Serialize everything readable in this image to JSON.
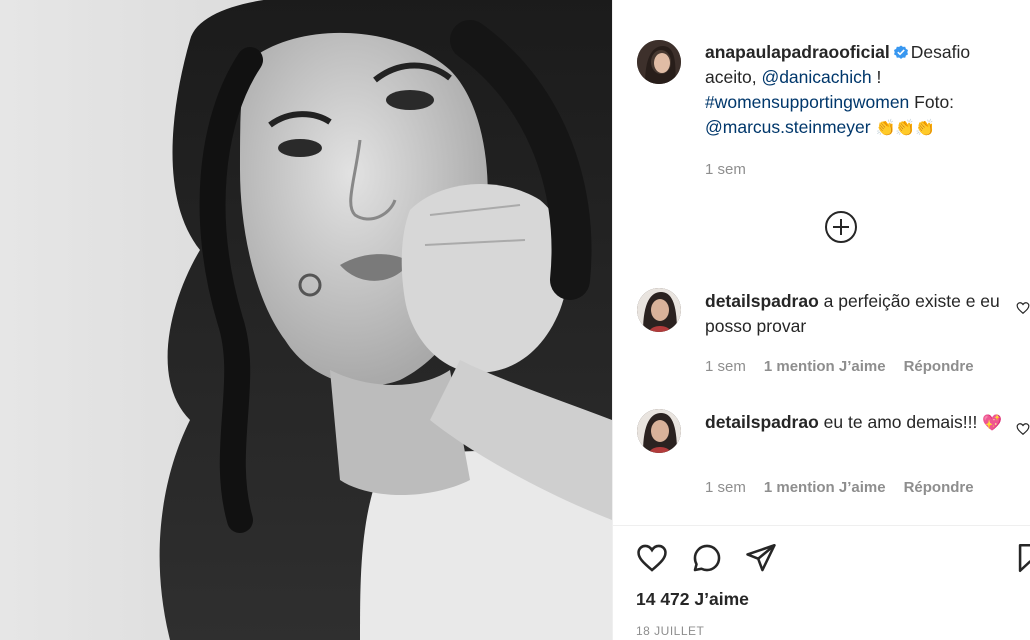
{
  "post": {
    "author": "anapaulapadraooficial",
    "caption_pre": "Desafio aceito, ",
    "mention_1": "@danicachich",
    "caption_mid": " ! ",
    "hashtag": "#womensupportingwomen",
    "caption_foto": " Foto: ",
    "mention_2": "@marcus.steinmeyer",
    "caption_emojis": "👏👏👏",
    "time": "1 sem"
  },
  "comments": [
    {
      "user": "detailspadrao",
      "text": "a perfeição existe e eu posso provar",
      "time": "1 sem",
      "likes": "1 mention J’aime",
      "reply": "Répondre"
    },
    {
      "user": "detailspadrao",
      "text": "eu te amo demais!!! ",
      "emoji": "💖",
      "time": "1 sem",
      "likes": "1 mention J’aime",
      "reply": "Répondre"
    }
  ],
  "footer": {
    "likes": "14 472 J’aime",
    "date": "18 JUILLET"
  },
  "colors": {
    "link": "#00376b",
    "secondary_text": "#8e8e8e",
    "verified": "#3897f0",
    "heart_emoji": "#d6263b"
  },
  "icons": [
    "verified-icon",
    "add-circle-icon",
    "heart-outline-icon",
    "comment-icon",
    "share-icon",
    "bookmark-icon"
  ]
}
